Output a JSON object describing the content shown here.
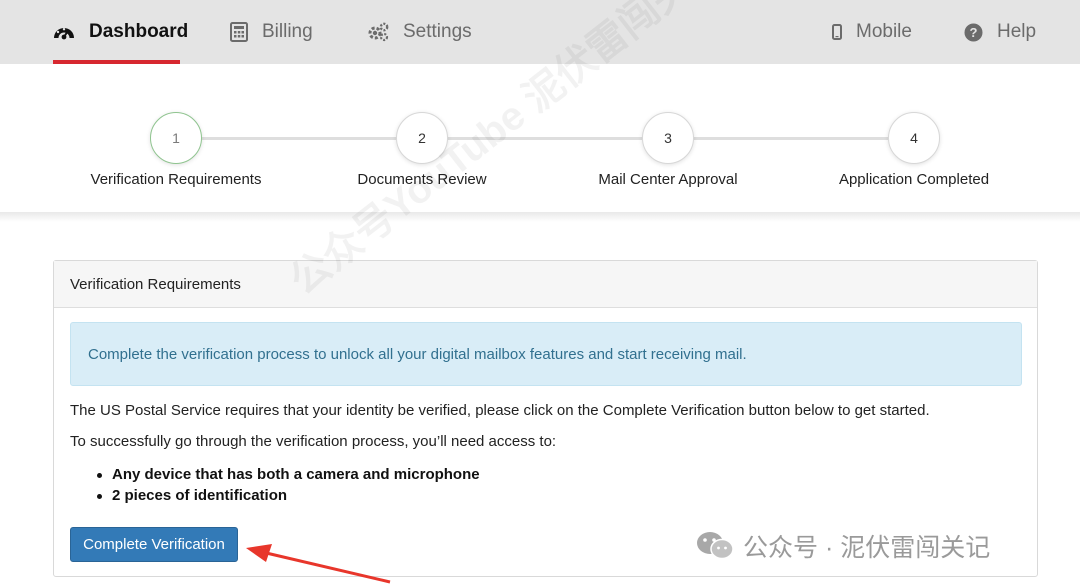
{
  "nav": {
    "dashboard": "Dashboard",
    "billing": "Billing",
    "settings": "Settings",
    "mobile": "Mobile",
    "help": "Help"
  },
  "steps": [
    {
      "number": "1",
      "label": "Verification Requirements"
    },
    {
      "number": "2",
      "label": "Documents Review"
    },
    {
      "number": "3",
      "label": "Mail Center Approval"
    },
    {
      "number": "4",
      "label": "Application Completed"
    }
  ],
  "panel": {
    "heading": "Verification Requirements",
    "alert": "Complete the verification process to unlock all your digital mailbox features and start receiving mail.",
    "intro": "The US Postal Service requires that your identity be verified, please click on the Complete Verification button below to get started.",
    "need_access": "To successfully go through the verification process, you’ll need access to:",
    "requirements": [
      "Any device that has both a camera and microphone",
      "2 pieces of identification"
    ],
    "button": "Complete Verification"
  },
  "watermark": {
    "diagonal": "公众号YouTube 泥伏雷闯关记",
    "corner": "公众号 · 泥伏雷闯关记"
  },
  "colors": {
    "accent_red": "#d7272f",
    "button_blue": "#337ab7",
    "alert_bg": "#d9edf7",
    "alert_text": "#31708f",
    "active_step_border": "#8fc48f"
  }
}
